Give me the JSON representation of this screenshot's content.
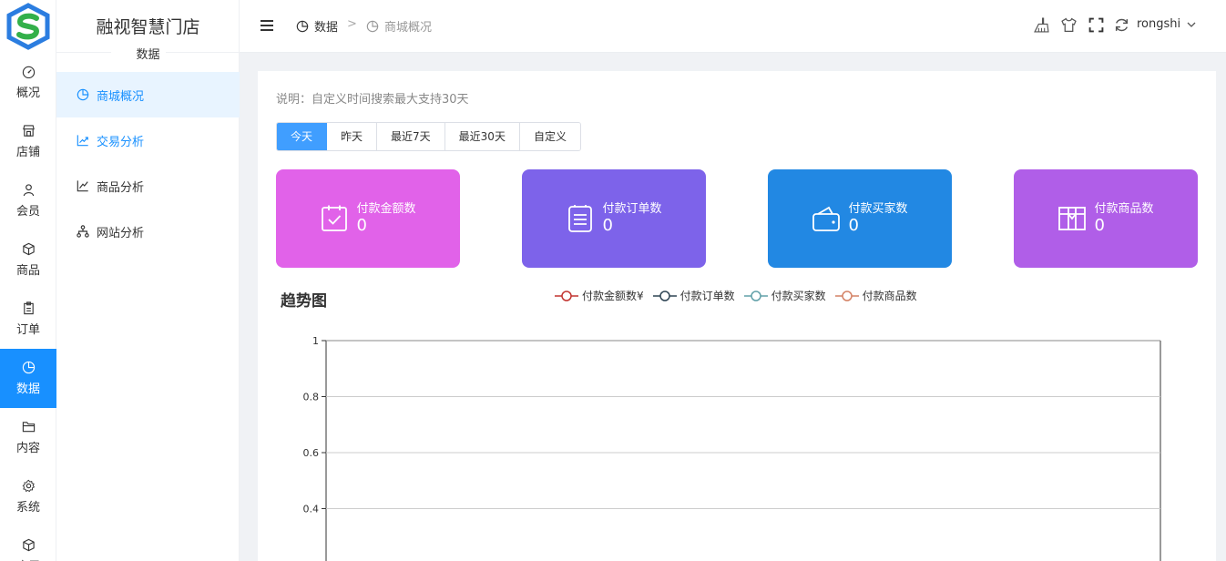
{
  "app": {
    "brand": "融视智慧门店"
  },
  "rail": {
    "items": [
      {
        "label": "概况",
        "icon": "dashboard-icon"
      },
      {
        "label": "店铺",
        "icon": "shop-icon"
      },
      {
        "label": "会员",
        "icon": "user-icon"
      },
      {
        "label": "商品",
        "icon": "box-icon"
      },
      {
        "label": "订单",
        "icon": "clipboard-icon"
      },
      {
        "label": "数据",
        "icon": "pie-chart-icon",
        "active": true
      },
      {
        "label": "内容",
        "icon": "folder-icon"
      },
      {
        "label": "系统",
        "icon": "gear-icon"
      },
      {
        "label": "应用",
        "icon": "cube-icon"
      }
    ]
  },
  "subnav": {
    "title": "数据",
    "items": [
      {
        "label": "商城概况",
        "icon": "pie-chart-icon",
        "active": true
      },
      {
        "label": "交易分析",
        "icon": "trend-up-icon"
      },
      {
        "label": "商品分析",
        "icon": "line-chart-icon"
      },
      {
        "label": "网站分析",
        "icon": "sitemap-icon"
      }
    ]
  },
  "header": {
    "breadcrumb": [
      "数据",
      "商城概况"
    ],
    "separator": ">",
    "username": "rongshi"
  },
  "main": {
    "note": "说明：自定义时间搜索最大支持30天",
    "tabs": [
      "今天",
      "昨天",
      "最近7天",
      "最近30天",
      "自定义"
    ],
    "active_tab": 0,
    "stats": [
      {
        "label": "付款金额数",
        "value": "0",
        "color": "#e162e9",
        "icon": "calendar-check-icon"
      },
      {
        "label": "付款订单数",
        "value": "0",
        "color": "#7d63ea",
        "icon": "list-icon"
      },
      {
        "label": "付款买家数",
        "value": "0",
        "color": "#2288e3",
        "icon": "wallet-icon"
      },
      {
        "label": "付款商品数",
        "value": "0",
        "color": "#b05ee8",
        "icon": "package-icon"
      }
    ],
    "trend_title": "趋势图"
  },
  "chart_data": {
    "type": "line",
    "title": "趋势图",
    "series": [
      {
        "name": "付款金额数¥",
        "color": "#c23531",
        "values": []
      },
      {
        "name": "付款订单数",
        "color": "#2f4554",
        "values": []
      },
      {
        "name": "付款买家数",
        "color": "#61a0a8",
        "values": []
      },
      {
        "name": "付款商品数",
        "color": "#d48265",
        "values": []
      }
    ],
    "yticks": [
      "1",
      "0.8",
      "0.6",
      "0.4"
    ],
    "ylim": [
      0,
      1
    ],
    "grid": true
  }
}
